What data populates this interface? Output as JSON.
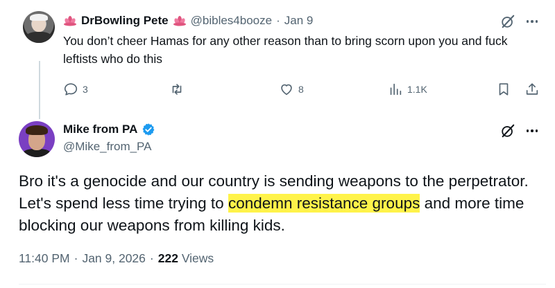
{
  "reply_tweet": {
    "display_name": "DrBowling Pete",
    "handle": "@bibles4booze",
    "date": "Jan 9",
    "text": "You don’t cheer Hamas for any other reason than to bring scorn upon you and fuck leftists who do this",
    "actions": {
      "replies": "3",
      "likes": "8",
      "views": "1.1K"
    },
    "icons": [
      "lotus-icon",
      "grok-icon",
      "more-icon",
      "reply-icon",
      "retweet-icon",
      "like-icon",
      "views-icon",
      "bookmark-icon",
      "share-icon"
    ]
  },
  "main_tweet": {
    "display_name": "Mike from PA",
    "handle": "@Mike_from_PA",
    "text_before": "Bro it's a genocide and our country is sending weapons to the perpetrator. Let's spend less time trying to ",
    "text_highlight": "condemn resistance groups",
    "text_after": " and more time blocking our weapons from killing kids.",
    "time": "11:40 PM",
    "date": "Jan 9, 2026",
    "separator": "·",
    "views_count": "222",
    "views_label": "Views",
    "highlight_color": "#fff34a",
    "verified_color": "#1d9bf0"
  }
}
